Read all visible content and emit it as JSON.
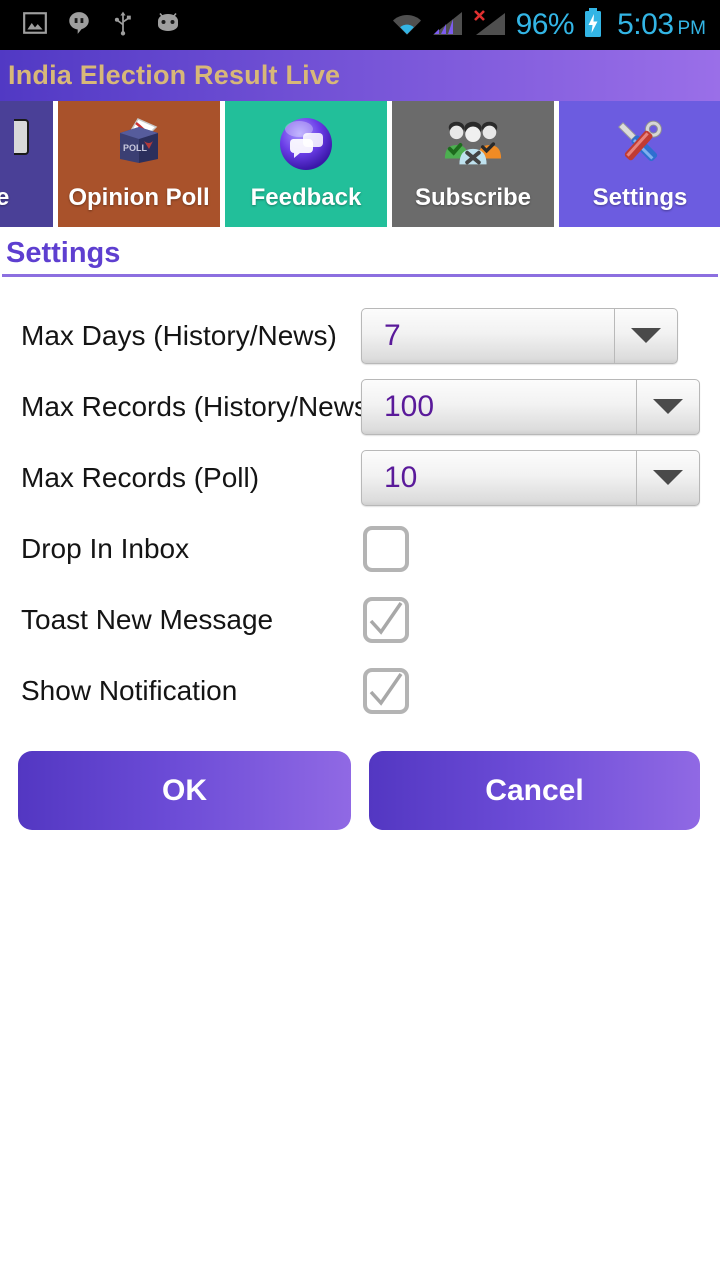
{
  "status_bar": {
    "left_icons": [
      "screenshot-image-icon",
      "hangouts-icon",
      "usb-icon",
      "android-mascot-icon"
    ],
    "wifi_icon": "wifi-icon",
    "signal_1_icon": "signal-bars-icon",
    "signal_2_icon": "signal-bars-no-sim-icon",
    "battery_percent": "96%",
    "battery_icon": "battery-charging-icon",
    "time": "5:03",
    "am_pm": "PM",
    "accent_color": "#33b5e5"
  },
  "title_bar": {
    "app_title": "India Election Result Live",
    "text_color": "#d8b878"
  },
  "tabs": [
    {
      "label": "e",
      "icon": "partial-tab-icon",
      "color": "#4a4097",
      "partial": true
    },
    {
      "label": "Opinion Poll",
      "icon": "ballot-box-icon",
      "color": "#a9522b"
    },
    {
      "label": "Feedback",
      "icon": "speech-bubbles-orb-icon",
      "color": "#22bf9a"
    },
    {
      "label": "Subscribe",
      "icon": "users-group-icon",
      "color": "#6b6b6b"
    },
    {
      "label": "Settings",
      "icon": "screwdriver-wrench-icon",
      "color": "#6c5ce0"
    },
    {
      "label": "",
      "icon": "scroll-chevrons-icon",
      "color": "#3e7b36",
      "partial": true
    }
  ],
  "section": {
    "title": "Settings",
    "title_color": "#5e3fd0"
  },
  "form": {
    "rows": [
      {
        "label": "Max Days (History/News)",
        "type": "spinner",
        "value": "7"
      },
      {
        "label": "Max Records (History/News)",
        "type": "spinner",
        "value": "100"
      },
      {
        "label": "Max Records (Poll)",
        "type": "spinner",
        "value": "10"
      },
      {
        "label": "Drop In Inbox",
        "type": "checkbox",
        "checked": false
      },
      {
        "label": "Toast New Message",
        "type": "checkbox",
        "checked": true
      },
      {
        "label": "Show Notification",
        "type": "checkbox",
        "checked": true
      }
    ],
    "value_color": "#5a1a9a"
  },
  "buttons": {
    "ok_label": "OK",
    "cancel_label": "Cancel",
    "gradient_from": "#5337c2",
    "gradient_to": "#9069e4"
  }
}
